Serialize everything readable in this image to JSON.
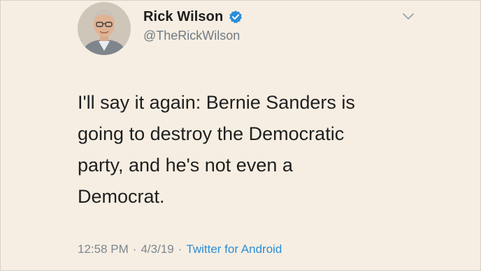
{
  "author": {
    "display_name": "Rick Wilson",
    "handle": "@TheRickWilson",
    "verified_icon": "verified-badge-icon"
  },
  "tweet": {
    "text": "I'll say it again: Bernie Sanders is\ngoing to destroy the Democratic\nparty, and he's not even a\nDemocrat."
  },
  "meta": {
    "time": "12:58 PM",
    "date": "4/3/19",
    "separator": "·",
    "source": "Twitter for Android"
  },
  "colors": {
    "background": "#f6eee2",
    "verified_blue": "#2a8ed8",
    "source_link": "#2a8ed8",
    "meta_gray": "#7b8691"
  },
  "menu": {
    "icon": "chevron-down-icon"
  }
}
